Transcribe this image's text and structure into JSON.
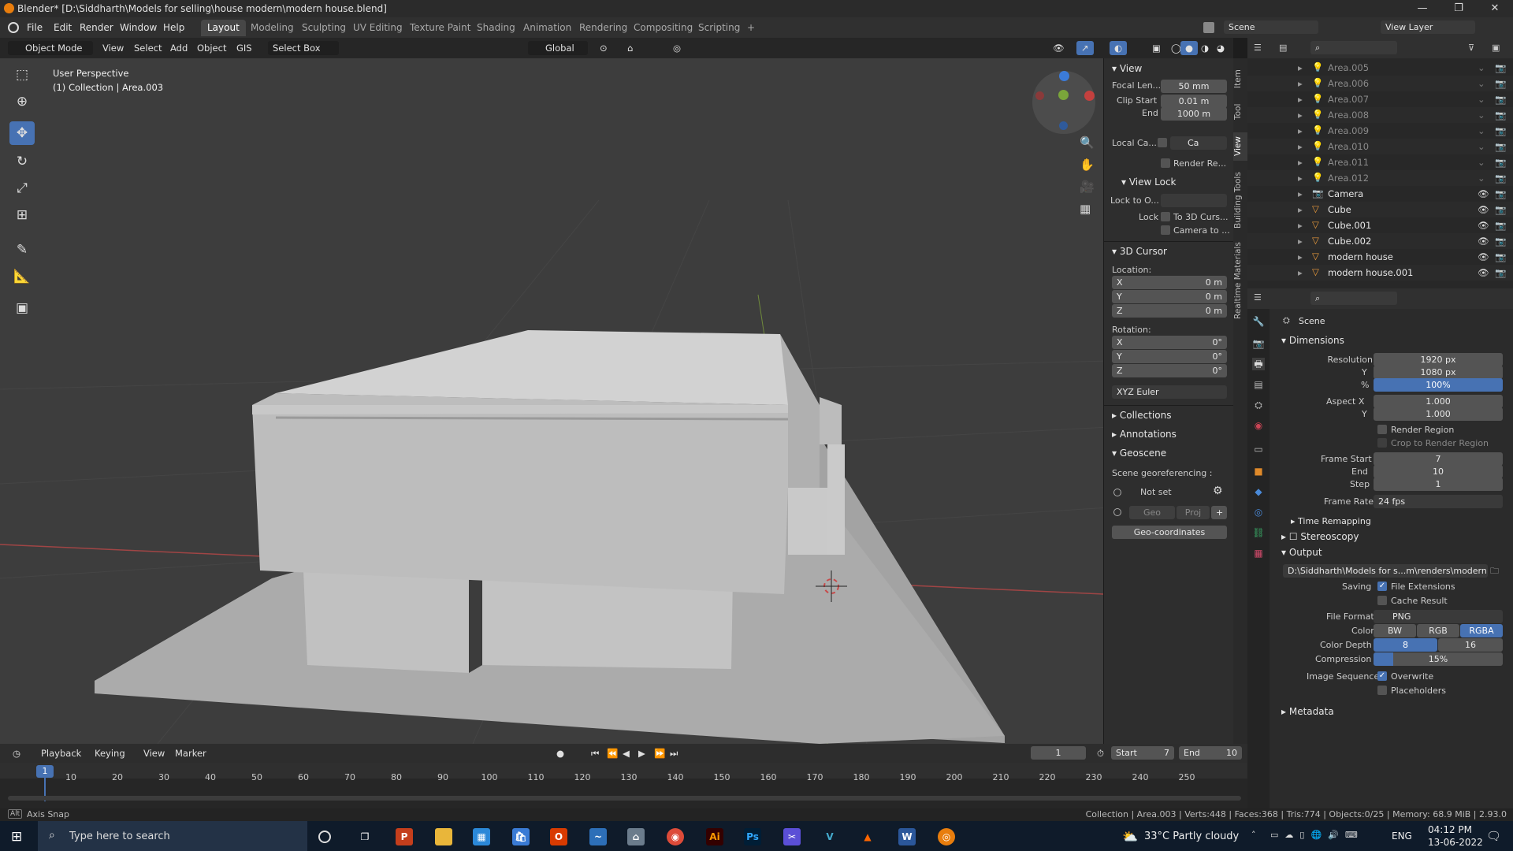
{
  "window": {
    "title": "Blender* [D:\\Siddharth\\Models for selling\\house modern\\modern house.blend]",
    "controls": [
      "—",
      "❐",
      "✕"
    ]
  },
  "menu": {
    "items": [
      "File",
      "Edit",
      "Render",
      "Window",
      "Help"
    ]
  },
  "workspaces": {
    "tabs": [
      "Layout",
      "Modeling",
      "Sculpting",
      "UV Editing",
      "Texture Paint",
      "Shading",
      "Animation",
      "Rendering",
      "Compositing",
      "Scripting"
    ],
    "active": "Layout"
  },
  "scene": {
    "label": "Scene",
    "view_layer": "View Layer"
  },
  "viewport_header": {
    "mode": "Object Mode",
    "view": "View",
    "select": "Select",
    "add": "Add",
    "object": "Object",
    "gis": "GIS",
    "select_box": "Select Box",
    "orientation": "Global"
  },
  "viewport": {
    "perspective": "User Perspective",
    "collection_info": "(1) Collection | Area.003"
  },
  "npanel": {
    "view_title": "View",
    "focal_label": "Focal Len...",
    "focal_value": "50 mm",
    "clip_start_label": "Clip Start",
    "clip_start_value": "0.01 m",
    "end_label": "End",
    "end_value": "1000 m",
    "local_cam_label": "Local Ca...",
    "local_cam_value": "Ca",
    "render_region_label": "Render Re...",
    "view_lock_title": "View Lock",
    "lock_to_label": "Lock to O...",
    "lock_label": "Lock",
    "lock_opt1": "To 3D Curs...",
    "lock_opt2": "Camera to ...",
    "cursor_title": "3D Cursor",
    "location_label": "Location:",
    "loc": [
      {
        "axis": "X",
        "value": "0 m"
      },
      {
        "axis": "Y",
        "value": "0 m"
      },
      {
        "axis": "Z",
        "value": "0 m"
      }
    ],
    "rotation_label": "Rotation:",
    "rot": [
      {
        "axis": "X",
        "value": "0°"
      },
      {
        "axis": "Y",
        "value": "0°"
      },
      {
        "axis": "Z",
        "value": "0°"
      }
    ],
    "rot_mode": "XYZ Euler",
    "collections": "Collections",
    "annotations": "Annotations",
    "geoscene": "Geoscene",
    "georef_label": "Scene georeferencing :",
    "not_set": "Not set",
    "geo": "Geo",
    "proj": "Proj",
    "geo_coords": "Geo-coordinates"
  },
  "sidebar_tabs": [
    "Item",
    "Tool",
    "View",
    "Building Tools",
    "Realtime Materials"
  ],
  "outliner": {
    "items": [
      {
        "name": "Area.005",
        "type": "light"
      },
      {
        "name": "Area.006",
        "type": "light"
      },
      {
        "name": "Area.007",
        "type": "light"
      },
      {
        "name": "Area.008",
        "type": "light"
      },
      {
        "name": "Area.009",
        "type": "light"
      },
      {
        "name": "Area.010",
        "type": "light"
      },
      {
        "name": "Area.011",
        "type": "light"
      },
      {
        "name": "Area.012",
        "type": "light"
      },
      {
        "name": "Camera",
        "type": "camera"
      },
      {
        "name": "Cube",
        "type": "mesh"
      },
      {
        "name": "Cube.001",
        "type": "mesh"
      },
      {
        "name": "Cube.002",
        "type": "mesh"
      },
      {
        "name": "modern house",
        "type": "mesh"
      },
      {
        "name": "modern house.001",
        "type": "mesh"
      }
    ]
  },
  "properties": {
    "scene": "Scene",
    "dimensions": "Dimensions",
    "res_x_label": "Resolution X",
    "res_x": "1920 px",
    "y_label": "Y",
    "res_y": "1080 px",
    "pct_label": "%",
    "pct": "100%",
    "aspect_x_label": "Aspect X",
    "aspect_x": "1.000",
    "aspect_y": "1.000",
    "render_region": "Render Region",
    "crop": "Crop to Render Region",
    "frame_start_label": "Frame Start",
    "frame_start": "7",
    "end_label": "End",
    "frame_end": "10",
    "step_label": "Step",
    "step": "1",
    "frame_rate_label": "Frame Rate",
    "frame_rate": "24 fps",
    "time_remap": "Time Remapping",
    "stereoscopy": "Stereoscopy",
    "output": "Output",
    "output_path": "D:\\Siddharth\\Models for s...m\\renders\\modern house",
    "saving_label": "Saving",
    "file_ext": "File Extensions",
    "cache": "Cache Result",
    "format_label": "File Format",
    "format": "PNG",
    "color_label": "Color",
    "color_bw": "BW",
    "color_rgb": "RGB",
    "color_rgba": "RGBA",
    "depth_label": "Color Depth",
    "depth_8": "8",
    "depth_16": "16",
    "compression_label": "Compression",
    "compression": "15%",
    "compression_fraction": 0.15,
    "img_seq_label": "Image Sequence",
    "overwrite": "Overwrite",
    "placeholders": "Placeholders",
    "metadata": "Metadata"
  },
  "timeline": {
    "playback": "Playback",
    "keying": "Keying",
    "view": "View",
    "marker": "Marker",
    "current": "1",
    "start_label": "Start",
    "start": "7",
    "end_label": "End",
    "end": "10",
    "ticks": [
      "10",
      "20",
      "30",
      "40",
      "50",
      "60",
      "70",
      "80",
      "90",
      "100",
      "110",
      "120",
      "130",
      "140",
      "150",
      "160",
      "170",
      "180",
      "190",
      "200",
      "210",
      "220",
      "230",
      "240",
      "250"
    ]
  },
  "status": {
    "left": "Axis Snap",
    "right": "Collection | Area.003 | Verts:448 | Faces:368 | Tris:774 | Objects:0/25 | Memory: 68.9 MiB | 2.93.0",
    "alt": "Alt"
  },
  "taskbar": {
    "search": "Type here to search",
    "weather": "33°C  Partly cloudy",
    "lang": "ENG",
    "time": "04:12 PM",
    "date": "13-06-2022"
  },
  "colors": {
    "accent": "#4772b3",
    "viewport_bg": "#3d3d3d",
    "panel_bg": "#2e2e2e",
    "x_axis": "#c4403e",
    "y_axis": "#7aa53a",
    "z_axis": "#3b7bd9"
  }
}
